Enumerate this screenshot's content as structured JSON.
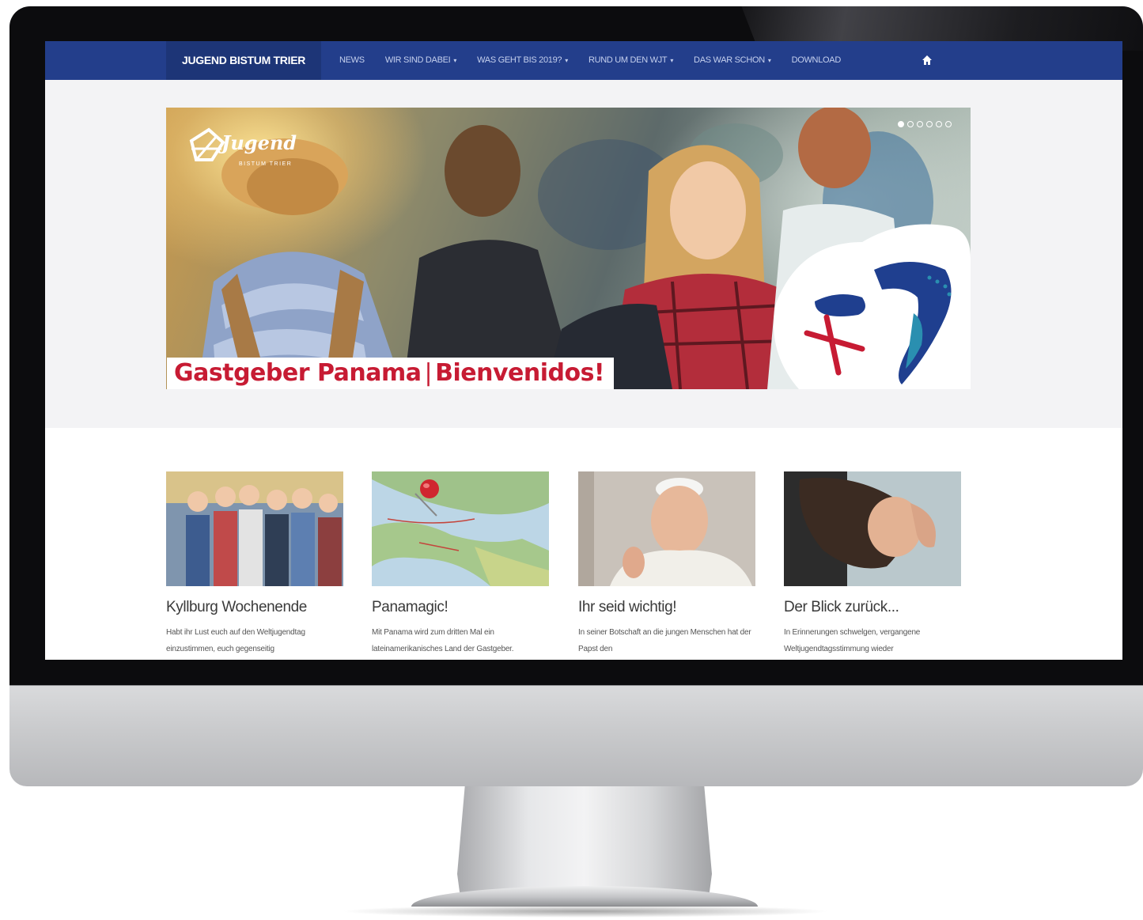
{
  "site": {
    "brand": "JUGEND BISTUM TRIER",
    "nav": [
      {
        "label": "NEWS",
        "dropdown": false
      },
      {
        "label": "WIR SIND DABEI",
        "dropdown": true
      },
      {
        "label": "WAS GEHT BIS 2019?",
        "dropdown": true
      },
      {
        "label": "RUND UM DEN WJT",
        "dropdown": true
      },
      {
        "label": "DAS WAR SCHON",
        "dropdown": true
      },
      {
        "label": "DOWNLOAD",
        "dropdown": false
      }
    ],
    "home_icon": "home-icon",
    "caret_glyph": "▾"
  },
  "hero": {
    "logo_text": "Jugend",
    "logo_subtext": "BISTUM TRIER",
    "caption_left": "Gastgeber Panama",
    "caption_separator": "|",
    "caption_right": "Bienvenidos!",
    "slides_total": 6,
    "active_slide": 1
  },
  "cards": [
    {
      "title": "Kyllburg Wochenende",
      "text": "Habt ihr Lust euch auf den Weltjugendtag einzustimmen, euch gegenseitig",
      "image": "group-photo"
    },
    {
      "title": "Panamagic!",
      "text": "Mit Panama wird zum dritten Mal ein lateinamerikanisches Land der Gastgeber.",
      "image": "map-with-pin"
    },
    {
      "title": "Ihr seid wichtig!",
      "text": "In seiner Botschaft an die jungen Menschen hat der Papst den",
      "image": "pope-photo"
    },
    {
      "title": "Der Blick zurück...",
      "text": "In Erinnerungen schwelgen, vergangene Weltjugendtagsstimmung wieder",
      "image": "woman-looking-photo"
    }
  ],
  "colors": {
    "nav_bg": "#233e8b",
    "brand_bg": "#1d3577",
    "caption_red": "#c71b33",
    "wyd_blue": "#1f3f8f",
    "wyd_teal": "#2a8fb0"
  }
}
